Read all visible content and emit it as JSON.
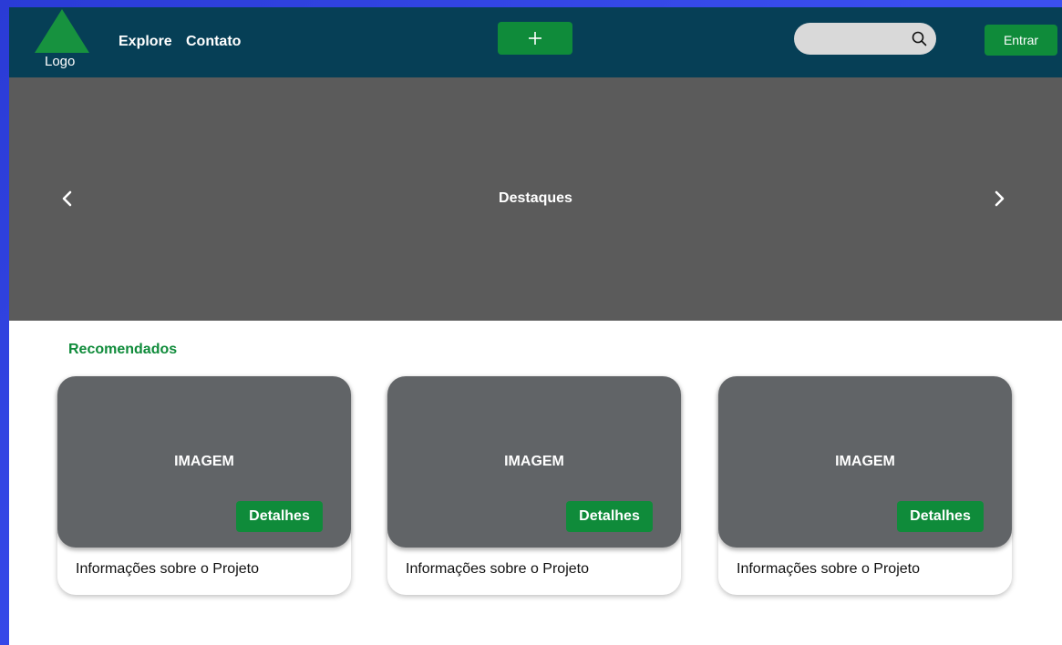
{
  "header": {
    "logo_text": "Logo",
    "nav": [
      {
        "label": "Explore"
      },
      {
        "label": "Contato"
      }
    ],
    "add_label": "+",
    "search": {
      "placeholder": "",
      "icon": "search-icon"
    },
    "login_label": "Entrar"
  },
  "hero": {
    "title": "Destaques",
    "prev_icon": "chevron-left-icon",
    "next_icon": "chevron-right-icon"
  },
  "recommended": {
    "title": "Recomendados",
    "cards": [
      {
        "image_label": "IMAGEM",
        "details_label": "Detalhes",
        "info": "Informações sobre o Projeto"
      },
      {
        "image_label": "IMAGEM",
        "details_label": "Detalhes",
        "info": "Informações sobre o Projeto"
      },
      {
        "image_label": "IMAGEM",
        "details_label": "Detalhes",
        "info": "Informações sobre o Projeto"
      }
    ]
  },
  "colors": {
    "background": "#3a4ef0",
    "navbar": "#063f56",
    "accent_green": "#0f8b3a",
    "hero": "#5b5b5b",
    "card_image": "#616467",
    "search_field": "#d9d9d9"
  }
}
